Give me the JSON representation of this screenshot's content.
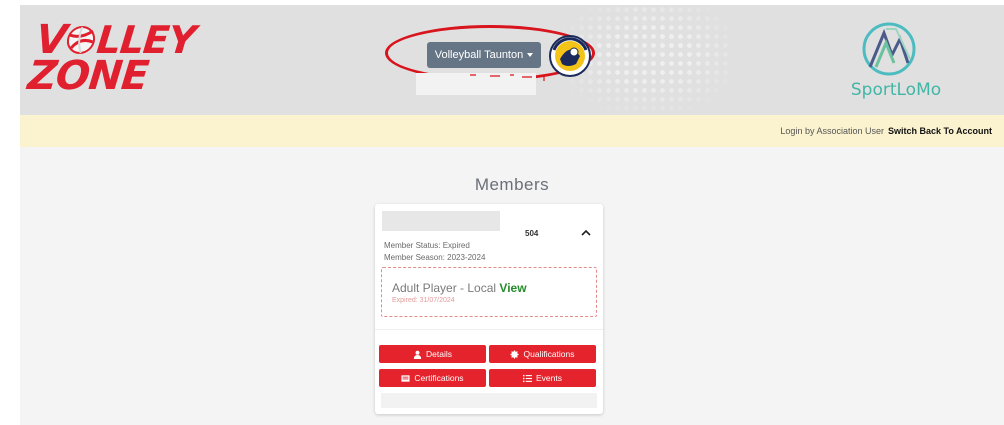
{
  "header": {
    "left_logo_line1": "LLEY",
    "left_logo_line1_prefix": "V",
    "left_logo_line2": "ZONE",
    "team_select_label": "Volleyball Taunton",
    "right_logo_text": "SportLoMo"
  },
  "login_bar": {
    "text": "Login by Association User",
    "switch_label": "Switch Back To Account"
  },
  "page": {
    "title": "Members"
  },
  "member_card": {
    "member_id_partial": "504",
    "status": "Member Status: Expired",
    "season": "Member Season: 2023-2024",
    "membership_name": "Adult Player - Local",
    "view_label": "View",
    "expired": "Expired: 31/07/2024"
  },
  "buttons": {
    "details": "Details",
    "qualifications": "Qualifications",
    "certifications": "Certifications",
    "events": "Events"
  },
  "colors": {
    "brand_red": "#e0202f",
    "button_red": "#e5232c",
    "team_button": "#667586",
    "login_bar_bg": "#fbf3cf",
    "view_green": "#268b2c",
    "sportlomo_teal": "#41b6a5"
  },
  "icons": {
    "team_caret": "caret-down-icon",
    "card_toggle": "chevron-up-icon",
    "details": "user-icon",
    "qualifications": "certificate-badge-icon",
    "certifications": "id-card-icon",
    "events": "list-icon"
  }
}
